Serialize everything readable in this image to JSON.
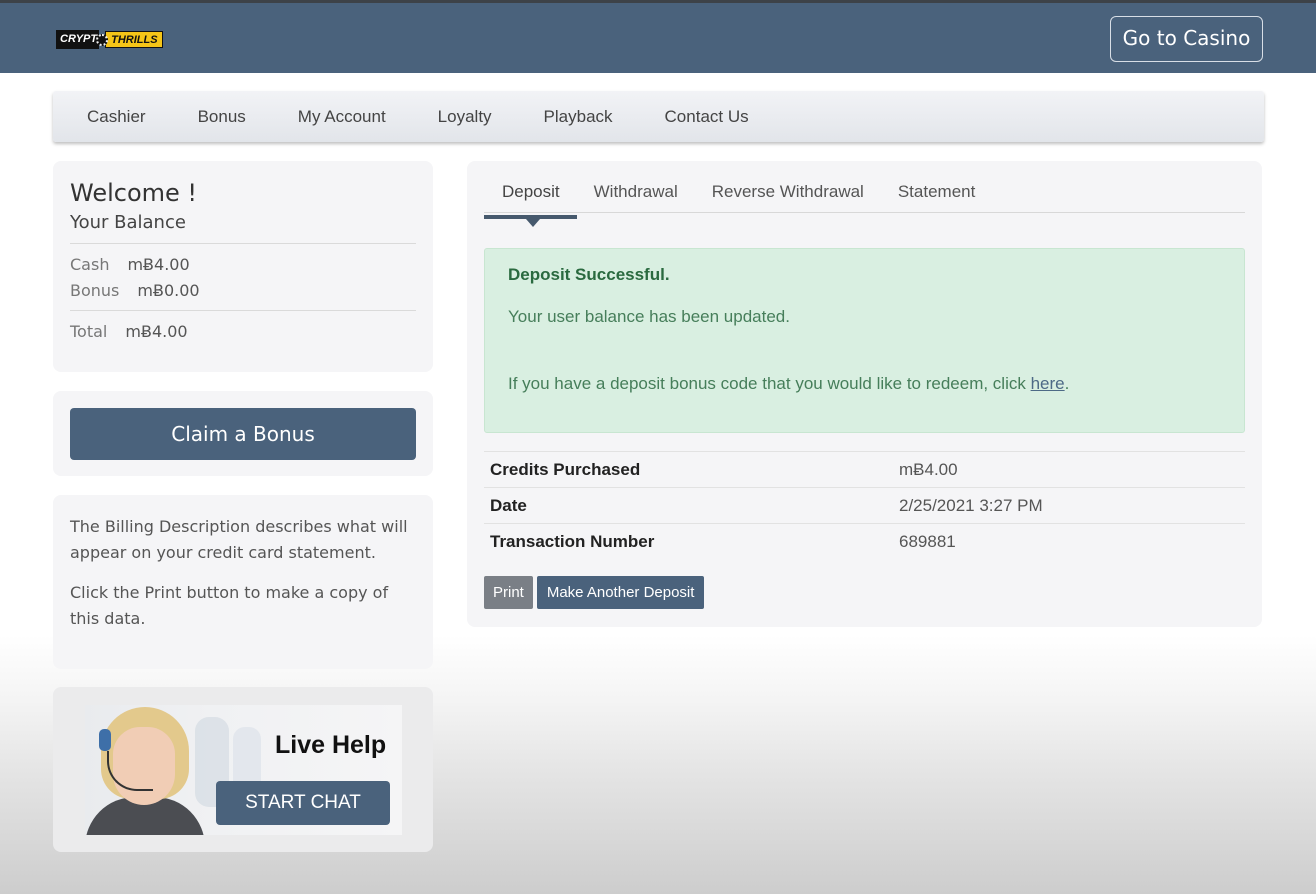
{
  "header": {
    "logo": {
      "part1": "CRYPT",
      "part2": "THRILLS"
    },
    "go_to_casino": "Go to Casino"
  },
  "nav": {
    "items": [
      "Cashier",
      "Bonus",
      "My Account",
      "Loyalty",
      "Playback",
      "Contact Us"
    ]
  },
  "balance": {
    "welcome": "Welcome !",
    "subtitle": "Your Balance",
    "cash_label": "Cash",
    "cash_value": "mɃ4.00",
    "bonus_label": "Bonus",
    "bonus_value": "mɃ0.00",
    "total_label": "Total",
    "total_value": "mɃ4.00"
  },
  "claim": {
    "label": "Claim a Bonus"
  },
  "info": {
    "p1": "The Billing Description describes what will appear on your credit card statement.",
    "p2": "Click the Print button to make a copy of this data."
  },
  "help": {
    "title": "Live Help",
    "button": "START CHAT"
  },
  "main": {
    "tabs": [
      {
        "label": "Deposit",
        "active": true
      },
      {
        "label": "Withdrawal",
        "active": false
      },
      {
        "label": "Reverse Withdrawal",
        "active": false
      },
      {
        "label": "Statement",
        "active": false
      }
    ],
    "alert": {
      "title": "Deposit Successful.",
      "line1": "Your user balance has been updated.",
      "line2_prefix": "If you have a deposit bonus code that you would like to redeem, click ",
      "link": "here",
      "line2_suffix": "."
    },
    "details": [
      {
        "label": "Credits Purchased",
        "value": "mɃ4.00"
      },
      {
        "label": "Date",
        "value": "2/25/2021 3:27 PM"
      },
      {
        "label": "Transaction Number",
        "value": "689881"
      }
    ],
    "buttons": {
      "print": "Print",
      "again": "Make Another Deposit"
    }
  },
  "colors": {
    "header_bg": "#4a627c",
    "primary_button": "#4a627c",
    "alert_bg": "#d9efe1",
    "alert_text": "#2a6a3f",
    "print_button": "#7a7f86"
  }
}
